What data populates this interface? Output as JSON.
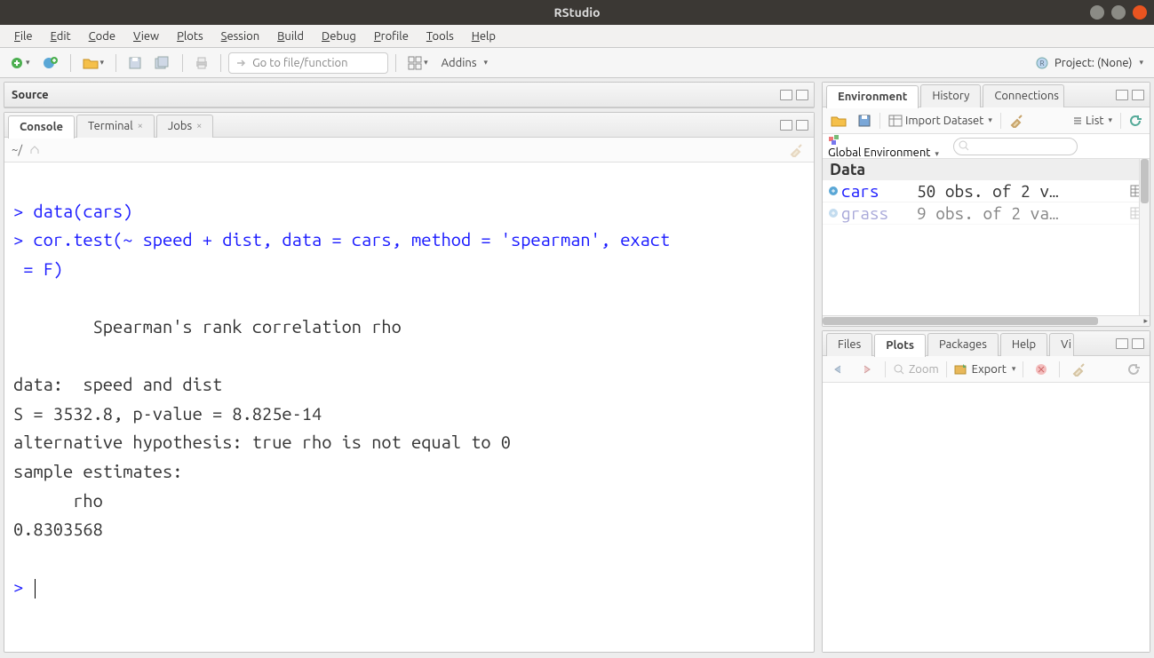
{
  "window": {
    "title": "RStudio"
  },
  "menu": {
    "file": "File",
    "edit": "Edit",
    "code": "Code",
    "view": "View",
    "plots": "Plots",
    "session": "Session",
    "build": "Build",
    "debug": "Debug",
    "profile": "Profile",
    "tools": "Tools",
    "help": "Help"
  },
  "toolbar": {
    "goto_placeholder": "Go to file/function",
    "addins_label": "Addins",
    "project_label": "Project: (None)"
  },
  "source_pane": {
    "title": "Source"
  },
  "console_pane": {
    "tabs": {
      "console": "Console",
      "terminal": "Terminal",
      "jobs": "Jobs"
    },
    "wd": "~/",
    "lines": {
      "l1a": "> ",
      "l1b": "data(cars)",
      "l2a": "> ",
      "l2b": "cor.test(~ speed + dist, data = cars, method = 'spearman', exact",
      "l3a": " = F)",
      "blank": "",
      "t1": "\tSpearman's rank correlation rho",
      "d1": "data:  speed and dist",
      "d2": "S = 3532.8, p-value = 8.825e-14",
      "d3": "alternative hypothesis: true rho is not equal to 0",
      "d4": "sample estimates:",
      "d5": "      rho ",
      "d6": "0.8303568 ",
      "p2": "> "
    }
  },
  "env_pane": {
    "tabs": {
      "environment": "Environment",
      "history": "History",
      "connections": "Connections"
    },
    "import_label": "Import Dataset",
    "list_label": "List",
    "scope_label": "Global Environment",
    "section": "Data",
    "rows": [
      {
        "name": "cars",
        "desc": "50 obs. of 2 v…"
      },
      {
        "name": "grass",
        "desc": "9 obs. of 2 va…"
      }
    ]
  },
  "plots_pane": {
    "tabs": {
      "files": "Files",
      "plots": "Plots",
      "packages": "Packages",
      "help": "Help",
      "viewer": "Viewer"
    },
    "zoom_label": "Zoom",
    "export_label": "Export"
  }
}
